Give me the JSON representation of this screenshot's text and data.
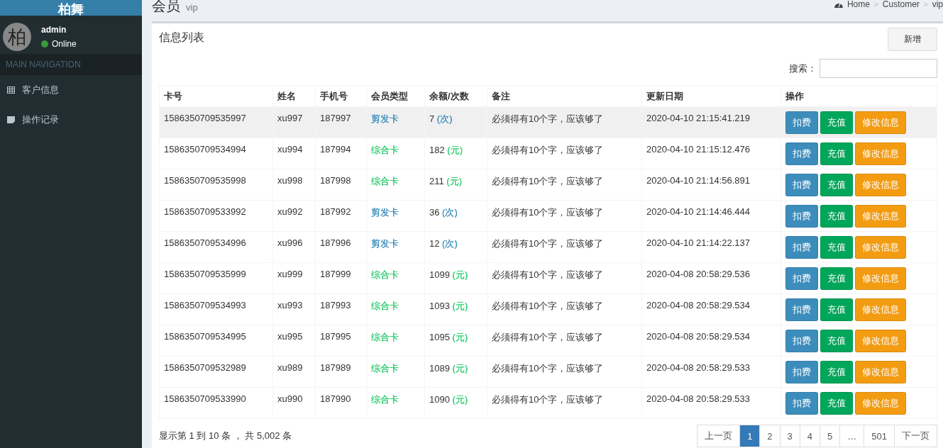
{
  "logo": "柏舞",
  "user": {
    "avatar": "柏",
    "name": "admin",
    "status": "Online",
    "online": true
  },
  "nav_header": "MAIN NAVIGATION",
  "nav": [
    {
      "label": "客户信息",
      "selected": false
    },
    {
      "label": "操作记录",
      "selected": false
    }
  ],
  "page": {
    "title": "会员",
    "subtitle": "vip"
  },
  "breadcrumb": [
    {
      "kind": "link",
      "label": "Home"
    },
    {
      "kind": "separator",
      "label": ">"
    },
    {
      "kind": "link",
      "label": "Customer"
    },
    {
      "kind": "separator",
      "label": ">"
    },
    {
      "kind": "link",
      "label": "vip"
    }
  ],
  "box": {
    "title": "信息列表",
    "add_button": "新增",
    "search_label": "搜索："
  },
  "table": {
    "columns": [
      "卡号",
      "姓名",
      "手机号",
      "会员类型",
      "余额/次数",
      "备注",
      "更新日期",
      "操作"
    ],
    "rows": [
      {
        "card": "1586350709535997",
        "name": "xu997",
        "phone": "187997",
        "type": {
          "label": "剪发卡",
          "color": "#3c8dbc"
        },
        "balance": "7",
        "unit": {
          "label": "(次)",
          "color": "#3c8dbc"
        },
        "note": "必须得有10个字，应该够了",
        "date": "2020-04-10 21:15:41.219",
        "selected": true,
        "actions": [
          {
            "label": "扣费",
            "color": "#3c8dbc"
          },
          {
            "label": "充值",
            "color": "#00a65a"
          },
          {
            "label": "修改信息",
            "color": "#f39c12"
          }
        ]
      },
      {
        "card": "1586350709534994",
        "name": "xu994",
        "phone": "187994",
        "type": {
          "label": "综合卡",
          "color": "#2ecc71"
        },
        "balance": "182",
        "unit": {
          "label": "(元)",
          "color": "#2ecc71"
        },
        "note": "必须得有10个字，应该够了",
        "date": "2020-04-10 21:15:12.476",
        "selected": false,
        "actions": [
          {
            "label": "扣费",
            "color": "#3c8dbc"
          },
          {
            "label": "充值",
            "color": "#00a65a"
          },
          {
            "label": "修改信息",
            "color": "#f39c12"
          }
        ]
      },
      {
        "card": "1586350709535998",
        "name": "xu998",
        "phone": "187998",
        "type": {
          "label": "综合卡",
          "color": "#2ecc71"
        },
        "balance": "211",
        "unit": {
          "label": "(元)",
          "color": "#2ecc71"
        },
        "note": "必须得有10个字，应该够了",
        "date": "2020-04-10 21:14:56.891",
        "selected": false,
        "actions": [
          {
            "label": "扣费",
            "color": "#3c8dbc"
          },
          {
            "label": "充值",
            "color": "#00a65a"
          },
          {
            "label": "修改信息",
            "color": "#f39c12"
          }
        ]
      },
      {
        "card": "1586350709533992",
        "name": "xu992",
        "phone": "187992",
        "type": {
          "label": "剪发卡",
          "color": "#3c8dbc"
        },
        "balance": "36",
        "unit": {
          "label": "(次)",
          "color": "#3c8dbc"
        },
        "note": "必须得有10个字，应该够了",
        "date": "2020-04-10 21:14:46.444",
        "selected": false,
        "actions": [
          {
            "label": "扣费",
            "color": "#3c8dbc"
          },
          {
            "label": "充值",
            "color": "#00a65a"
          },
          {
            "label": "修改信息",
            "color": "#f39c12"
          }
        ]
      },
      {
        "card": "1586350709534996",
        "name": "xu996",
        "phone": "187996",
        "type": {
          "label": "剪发卡",
          "color": "#3c8dbc"
        },
        "balance": "12",
        "unit": {
          "label": "(次)",
          "color": "#3c8dbc"
        },
        "note": "必须得有10个字，应该够了",
        "date": "2020-04-10 21:14:22.137",
        "selected": false,
        "actions": [
          {
            "label": "扣费",
            "color": "#3c8dbc"
          },
          {
            "label": "充值",
            "color": "#00a65a"
          },
          {
            "label": "修改信息",
            "color": "#f39c12"
          }
        ]
      },
      {
        "card": "1586350709535999",
        "name": "xu999",
        "phone": "187999",
        "type": {
          "label": "综合卡",
          "color": "#2ecc71"
        },
        "balance": "1099",
        "unit": {
          "label": "(元)",
          "color": "#2ecc71"
        },
        "note": "必须得有10个字，应该够了",
        "date": "2020-04-08 20:58:29.536",
        "selected": false,
        "actions": [
          {
            "label": "扣费",
            "color": "#3c8dbc"
          },
          {
            "label": "充值",
            "color": "#00a65a"
          },
          {
            "label": "修改信息",
            "color": "#f39c12"
          }
        ]
      },
      {
        "card": "1586350709534993",
        "name": "xu993",
        "phone": "187993",
        "type": {
          "label": "综合卡",
          "color": "#2ecc71"
        },
        "balance": "1093",
        "unit": {
          "label": "(元)",
          "color": "#2ecc71"
        },
        "note": "必须得有10个字，应该够了",
        "date": "2020-04-08 20:58:29.534",
        "selected": false,
        "actions": [
          {
            "label": "扣费",
            "color": "#3c8dbc"
          },
          {
            "label": "充值",
            "color": "#00a65a"
          },
          {
            "label": "修改信息",
            "color": "#f39c12"
          }
        ]
      },
      {
        "card": "1586350709534995",
        "name": "xu995",
        "phone": "187995",
        "type": {
          "label": "综合卡",
          "color": "#2ecc71"
        },
        "balance": "1095",
        "unit": {
          "label": "(元)",
          "color": "#2ecc71"
        },
        "note": "必须得有10个字，应该够了",
        "date": "2020-04-08 20:58:29.534",
        "selected": false,
        "actions": [
          {
            "label": "扣费",
            "color": "#3c8dbc"
          },
          {
            "label": "充值",
            "color": "#00a65a"
          },
          {
            "label": "修改信息",
            "color": "#f39c12"
          }
        ]
      },
      {
        "card": "1586350709532989",
        "name": "xu989",
        "phone": "187989",
        "type": {
          "label": "综合卡",
          "color": "#2ecc71"
        },
        "balance": "1089",
        "unit": {
          "label": "(元)",
          "color": "#2ecc71"
        },
        "note": "必须得有10个字，应该够了",
        "date": "2020-04-08 20:58:29.533",
        "selected": false,
        "actions": [
          {
            "label": "扣费",
            "color": "#3c8dbc"
          },
          {
            "label": "充值",
            "color": "#00a65a"
          },
          {
            "label": "修改信息",
            "color": "#f39c12"
          }
        ]
      },
      {
        "card": "1586350709533990",
        "name": "xu990",
        "phone": "187990",
        "type": {
          "label": "综合卡",
          "color": "#2ecc71"
        },
        "balance": "1090",
        "unit": {
          "label": "(元)",
          "color": "#2ecc71"
        },
        "note": "必须得有10个字，应该够了",
        "date": "2020-04-08 20:58:29.533",
        "selected": false,
        "actions": [
          {
            "label": "扣费",
            "color": "#3c8dbc"
          },
          {
            "label": "充值",
            "color": "#00a65a"
          },
          {
            "label": "修改信息",
            "color": "#f39c12"
          }
        ]
      }
    ]
  },
  "footer": {
    "info": "显示第 1 到 10 条 ， 共 5,002 条"
  },
  "pagination": [
    {
      "label": "上一页",
      "selected": false
    },
    {
      "label": "1",
      "selected": true
    },
    {
      "label": "2",
      "selected": false
    },
    {
      "label": "3",
      "selected": false
    },
    {
      "label": "4",
      "selected": false
    },
    {
      "label": "5",
      "selected": false
    },
    {
      "label": "…",
      "selected": false
    },
    {
      "label": "501",
      "selected": false
    },
    {
      "label": "下一页",
      "selected": false
    }
  ]
}
